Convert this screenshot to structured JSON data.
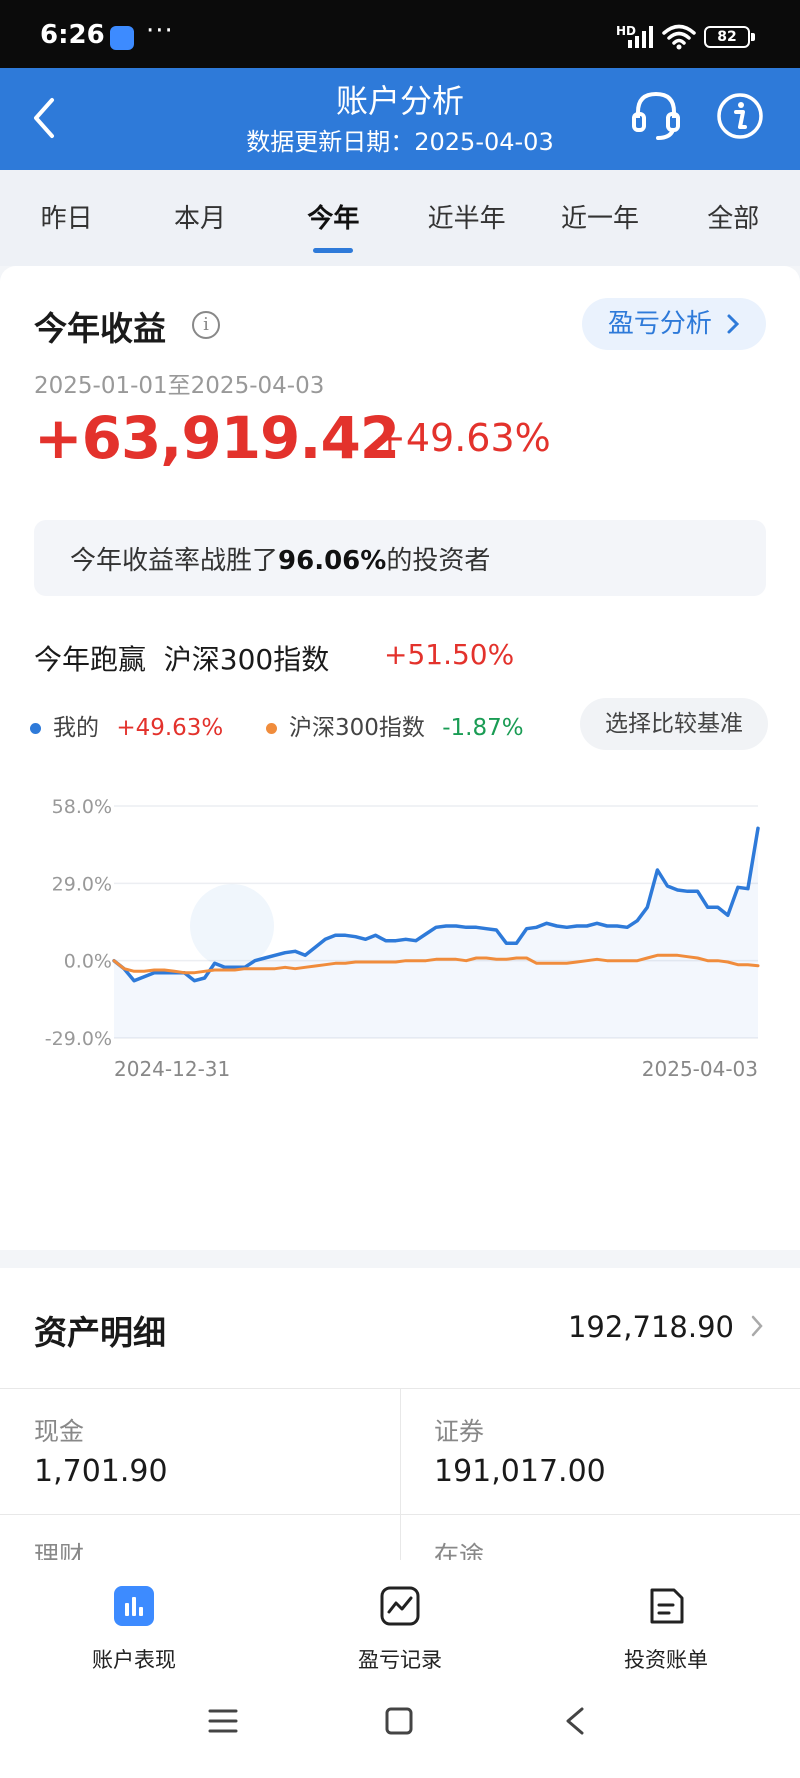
{
  "status": {
    "time": "6:26",
    "dots": "···",
    "network": "HD",
    "battery": "82"
  },
  "header": {
    "title": "账户分析",
    "subtitle": "数据更新日期：2025-04-03"
  },
  "tabs": [
    "昨日",
    "本月",
    "今年",
    "近半年",
    "近一年",
    "全部"
  ],
  "active_tab": "今年",
  "summary": {
    "title": "今年收益",
    "info_glyph": "i",
    "pl_button": "盈亏分析",
    "date_range": "2025-01-01至2025-04-03",
    "profit": "+63,919.42",
    "profit_pct": "+49.63%",
    "beat_prefix": "今年收益率战胜了",
    "beat_pct": "96.06%",
    "beat_suffix": "的投资者",
    "run_title": "今年跑赢  沪深300指数",
    "run_pct": "+51.50%"
  },
  "legend": {
    "mine_label": "我的",
    "mine_value": "+49.63%",
    "index_label": "沪深300指数",
    "index_value": "-1.87%",
    "compare_button": "选择比较基准"
  },
  "colors": {
    "accent": "#2e7ad9",
    "up": "#e3322c",
    "down": "#1a9c54",
    "series_mine": "#2e7ad9",
    "series_index": "#f08c3c"
  },
  "chart_data": {
    "type": "line",
    "yticks": [
      "58.0%",
      "29.0%",
      "0.0%",
      "-29.0%"
    ],
    "ylim": [
      -29,
      58
    ],
    "xlabels": [
      "2024-12-31",
      "2025-04-03"
    ],
    "grid": true,
    "series": [
      {
        "name": "我的",
        "values": [
          0,
          -3,
          -7.5,
          -6,
          -4.5,
          -4.5,
          -4.5,
          -4.5,
          -7.5,
          -6.5,
          -1,
          -2.5,
          -2.5,
          -2.5,
          0,
          1,
          2,
          3,
          3.5,
          2,
          5,
          8,
          9.5,
          9.5,
          9,
          8,
          9.5,
          7.5,
          7.5,
          8,
          7.5,
          10,
          12.5,
          13,
          13,
          12.5,
          12.5,
          12,
          11.5,
          6.5,
          6.5,
          12,
          12.5,
          14,
          13,
          12.5,
          13,
          13,
          14,
          13,
          13,
          12.5,
          15,
          20,
          34,
          28,
          26.5,
          26,
          26,
          20,
          20,
          17,
          27.5,
          27,
          49.63
        ]
      },
      {
        "name": "沪深300指数",
        "values": [
          0,
          -3,
          -4,
          -4,
          -3.5,
          -3.5,
          -4,
          -4.5,
          -4.5,
          -4,
          -3.5,
          -3.5,
          -3.5,
          -3,
          -3,
          -3,
          -3,
          -2.5,
          -3,
          -2.5,
          -2,
          -1.5,
          -1,
          -1,
          -0.5,
          -0.5,
          -0.5,
          -0.5,
          -0.5,
          0,
          0,
          0,
          0.5,
          0.5,
          0.5,
          0,
          1,
          1,
          0.5,
          0.5,
          1,
          1,
          -1,
          -1,
          -1,
          -1,
          -0.5,
          0,
          0.5,
          0,
          0,
          0,
          0,
          1,
          2,
          2,
          2,
          1.5,
          1,
          0,
          0,
          -0.5,
          -1.5,
          -1.5,
          -1.87
        ]
      }
    ]
  },
  "assets": {
    "title": "资产明细",
    "total": "192,718.90",
    "cash_label": "现金",
    "cash_value": "1,701.90",
    "sec_label": "证券",
    "sec_value": "191,017.00",
    "fin_label": "理财",
    "transit_label": "在途"
  },
  "bottom_nav": [
    "账户表现",
    "盈亏记录",
    "投资账单"
  ]
}
